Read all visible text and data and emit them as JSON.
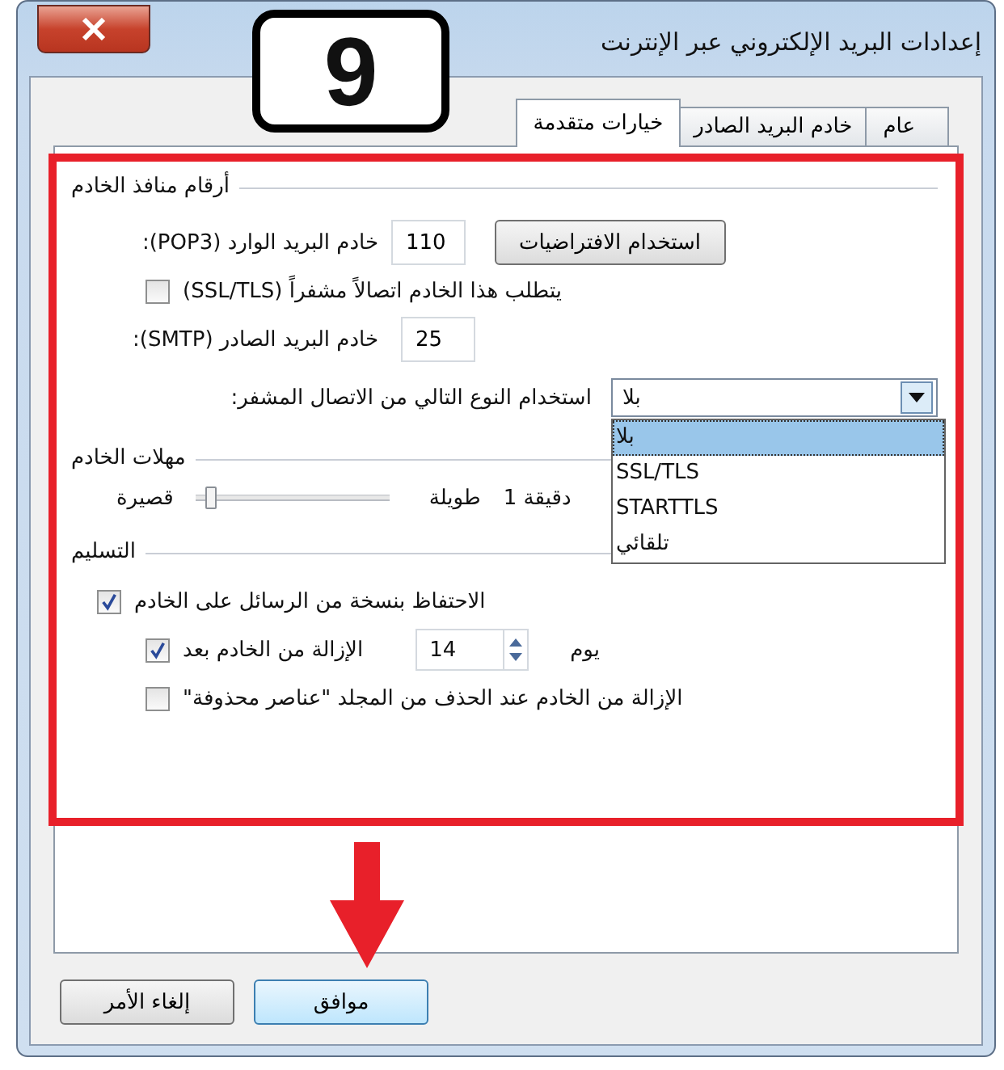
{
  "window": {
    "title": "إعدادات البريد الإلكتروني عبر الإنترنت"
  },
  "annotation": {
    "step": "9"
  },
  "tabs": [
    {
      "label": "عام",
      "selected": false
    },
    {
      "label": "خادم البريد الصادر",
      "selected": false
    },
    {
      "label": "خيارات متقدمة",
      "selected": true
    }
  ],
  "server_ports": {
    "title": "أرقام منافذ الخادم",
    "incoming_label": "خادم البريد الوارد (POP3):",
    "incoming_value": "110",
    "defaults_button": "استخدام الافتراضيات",
    "ssl_checkbox": {
      "label": "يتطلب هذا الخادم اتصالاً مشفراً (SSL/TLS)",
      "checked": false
    },
    "outgoing_label": "خادم البريد الصادر (SMTP):",
    "outgoing_value": "25",
    "encryption_label": "استخدام النوع التالي من الاتصال المشفر:",
    "encryption_value": "بلا",
    "encryption_options": [
      {
        "label": "بلا",
        "selected": true
      },
      {
        "label": "SSL/TLS",
        "selected": false
      },
      {
        "label": "STARTTLS",
        "selected": false
      },
      {
        "label": "تلقائي",
        "selected": false
      }
    ]
  },
  "server_timeouts": {
    "title": "مهلات الخادم",
    "short_label": "قصيرة",
    "long_label": "طويلة",
    "level": 0.05,
    "reading": "دقيقة 1"
  },
  "delivery": {
    "title": "التسليم",
    "keep_copy": {
      "label": "الاحتفاظ بنسخة من الرسائل على الخادم",
      "checked": true
    },
    "remove_after": {
      "label": "الإزالة من الخادم بعد",
      "checked": true,
      "days": "14",
      "unit": "يوم"
    },
    "remove_deleted": {
      "label": "الإزالة من الخادم عند الحذف من المجلد \"عناصر محذوفة\"",
      "checked": false
    }
  },
  "buttons": [
    {
      "label": "موافق",
      "kind": "default"
    },
    {
      "label": "إلغاء الأمر",
      "kind": "normal"
    }
  ]
}
